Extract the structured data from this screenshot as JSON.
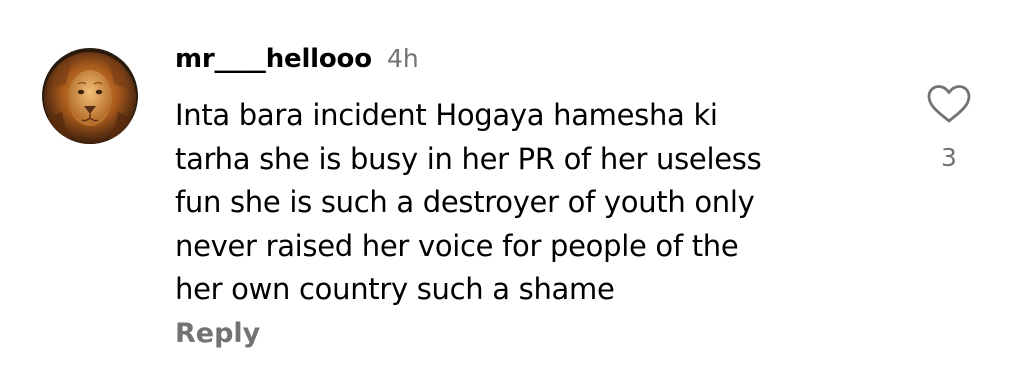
{
  "comment": {
    "username": "mr____hellooo",
    "time_ago": "4h",
    "text_lines": [
      "Inta bara incident Hogaya hamesha ki",
      "tarha she is busy in her PR of her useless",
      "fun she is such a destroyer of youth only",
      "never raised her voice for people of the",
      "her own country such a shame"
    ],
    "reply_label": "Reply",
    "like_count": "3",
    "like_icon": "heart-outline-icon",
    "avatar_icon": "lion-avatar-icon"
  },
  "colors": {
    "text": "#000000",
    "secondary_text": "#737373",
    "background": "#ffffff"
  }
}
